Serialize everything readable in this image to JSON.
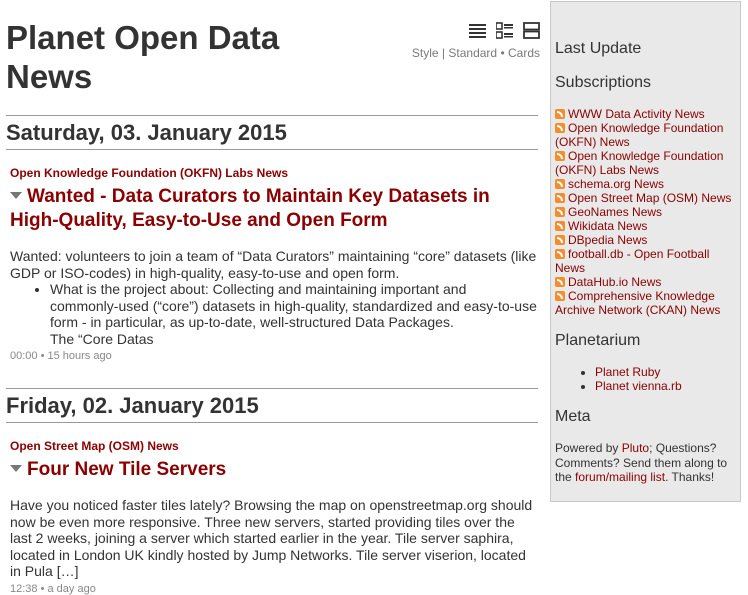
{
  "site": {
    "title": "Planet Open Data News"
  },
  "style_switcher": {
    "icons": [
      "list-icon",
      "standard-icon",
      "cards-icon"
    ],
    "style_label": "Style",
    "separator": "|",
    "standard": "Standard",
    "bullet": "•",
    "cards": "Cards"
  },
  "days": [
    {
      "date": "Saturday, 03. January 2015",
      "items": [
        {
          "feed": "Open Knowledge Foundation (OKFN) Labs News",
          "title": "Wanted - Data Curators to Maintain Key Datasets in High-Quality, Easy-to-Use and Open Form",
          "summary": "Wanted: volunteers to join a team of “Data Curators” maintaining “core” datasets (like GDP or ISO-codes) in high-quality, easy-to-use and open form.",
          "bullet": "What is the project about: Collecting and maintaining important and commonly-used (“core”) datasets in high-quality, standardized and easy-to-use form - in particular, as up-to-date, well-structured Data Packages.",
          "bullet_tail": "The “Core Datas",
          "time": "00:00",
          "ago": "15 hours ago"
        }
      ]
    },
    {
      "date": "Friday, 02. January 2015",
      "items": [
        {
          "feed": "Open Street Map (OSM) News",
          "title": "Four New Tile Servers",
          "summary": "Have you noticed faster tiles lately? Browsing the map on openstreetmap.org should now be even more responsive. Three new servers, started providing tiles over the last 2 weeks, joining a server which started earlier in the year. Tile server saphira, located in London UK kindly hosted by Jump Networks. Tile server viserion, located in Pula […]",
          "time": "12:38",
          "ago": "a day ago"
        }
      ]
    }
  ],
  "sidebar": {
    "last_update_heading": "Last Update",
    "subscriptions_heading": "Subscriptions",
    "subscriptions": [
      "WWW Data Activity News",
      "Open Knowledge Foundation (OKFN) News",
      "Open Knowledge Foundation (OKFN) Labs News",
      "schema.org News",
      "Open Street Map (OSM) News",
      "GeoNames News",
      "Wikidata News",
      "DBpedia News",
      "football.db - Open Football News",
      "DataHub.io News",
      "Comprehensive Knowledge Archive Network (CKAN) News"
    ],
    "planetarium_heading": "Planetarium",
    "planetarium": [
      "Planet Ruby",
      "Planet vienna.rb"
    ],
    "meta_heading": "Meta",
    "meta": {
      "powered_by": "Powered by",
      "pluto": "Pluto",
      "text": "; Questions? Comments? Send them along to the",
      "forum": "forum/mailing list",
      "thanks": ". Thanks!"
    }
  },
  "colors": {
    "link": "#8b0000",
    "sidebar_bg": "#e9e9e9",
    "feed_icon": "#f48d2c",
    "meta_text": "#888888"
  }
}
